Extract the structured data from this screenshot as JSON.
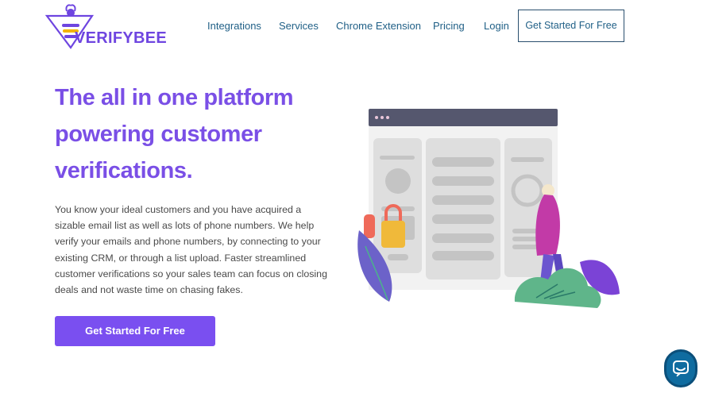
{
  "brand": {
    "name": "VERIFYBEE",
    "accent": "#7a4fe6",
    "nav_color": "#1f5f86"
  },
  "nav": {
    "links": [
      {
        "label": "Integrations"
      },
      {
        "label": "Services"
      },
      {
        "label": "Chrome Extension"
      },
      {
        "label": "Pricing"
      },
      {
        "label": "Login"
      }
    ],
    "cta_label": "Get Started For Free"
  },
  "hero": {
    "headline": "The all in one platform powering customer verifications.",
    "description": "You know your ideal customers and you have acquired a sizable email list as well as lots of phone numbers. We help verify your emails and phone numbers, by connecting to your existing CRM, or through a list upload. Faster streamlined customer verifications so your sales team can focus on closing deals and not waste time on chasing fakes.",
    "cta_label": "Get Started For Free",
    "cta_color": "#7a4ff0"
  },
  "illustration": {
    "icon": "dashboard-illustration"
  },
  "chat": {
    "icon": "chat-bubble-icon",
    "color": "#0f6ca0"
  }
}
